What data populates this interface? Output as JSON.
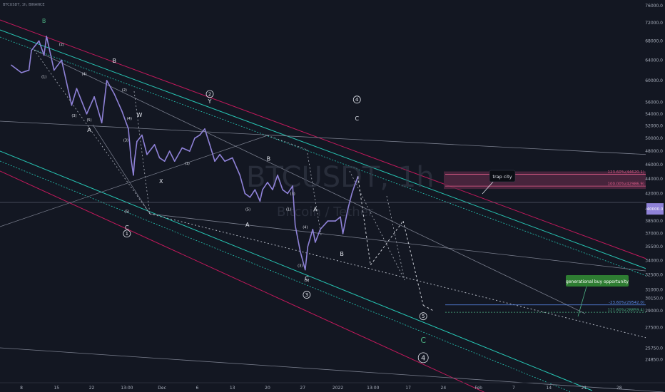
{
  "symbol": "BTCUSDT, 1h, BINANCE",
  "watermark": {
    "pair": "BTCUSDT, 1h",
    "name": "Bitcoin / Tether"
  },
  "colors": {
    "background": "#131722",
    "price": "#8f82d8",
    "wave_white": "#e0e3eb",
    "wave_green": "#4caf82",
    "wave_pink": "#e05c8a",
    "channel_teal": "#26c6b4",
    "channel_pink": "#c2185b",
    "resistance_zone": "#5a2a45",
    "current_price_tag": "#8f82d8"
  },
  "chart_data": {
    "type": "line",
    "title": "",
    "xlabel": "",
    "ylabel": "",
    "ylim": [
      24000,
      76000
    ],
    "y_scale": "log",
    "y_ticks": [
      "76000.0",
      "72000.0",
      "68000.0",
      "64000.0",
      "60000.0",
      "56000.0",
      "54000.0",
      "52000.0",
      "50000.0",
      "48000.0",
      "46000.0",
      "44000.0",
      "42000.0",
      "40000.0",
      "38500.0",
      "37000.0",
      "35500.0",
      "34000.0",
      "32500.0",
      "31000.0",
      "30150.0",
      "29000.0",
      "27500.0",
      "25750.0",
      "24850.0"
    ],
    "x_ticks": [
      "8",
      "15",
      "22",
      "13:00",
      "Dec",
      "6",
      "13",
      "20",
      "27",
      "2022",
      "13:00",
      "17",
      "24",
      "Feb",
      "7",
      "14",
      "21",
      "28"
    ],
    "series": [
      {
        "values": [
          [
            -2,
            63000
          ],
          [
            0,
            61500
          ],
          [
            1.5,
            62000
          ],
          [
            2,
            66000
          ],
          [
            3.5,
            68000
          ],
          [
            4.5,
            65000
          ],
          [
            5,
            69000
          ],
          [
            6.5,
            62000
          ],
          [
            8,
            64000
          ],
          [
            10,
            55500
          ],
          [
            11,
            58500
          ],
          [
            13,
            54000
          ],
          [
            14.5,
            57000
          ],
          [
            16,
            52500
          ],
          [
            17,
            60000
          ],
          [
            18.5,
            57500
          ],
          [
            20,
            54500
          ],
          [
            21.3,
            51500
          ],
          [
            21.8,
            47000
          ],
          [
            22.3,
            44500
          ],
          [
            22.5,
            46500
          ],
          [
            23,
            49500
          ],
          [
            24,
            50500
          ],
          [
            25,
            47500
          ],
          [
            26.5,
            49000
          ],
          [
            27.5,
            47000
          ],
          [
            28.5,
            46500
          ],
          [
            29.5,
            48000
          ],
          [
            30.5,
            46500
          ],
          [
            32,
            48500
          ],
          [
            33.5,
            48000
          ],
          [
            34.5,
            50000
          ],
          [
            35.5,
            50500
          ],
          [
            36.5,
            51500
          ],
          [
            37.5,
            49000
          ],
          [
            38.5,
            46500
          ],
          [
            39.5,
            47500
          ],
          [
            40.5,
            46500
          ],
          [
            42,
            47000
          ],
          [
            43.5,
            44500
          ],
          [
            44.5,
            42000
          ],
          [
            45.5,
            41500
          ],
          [
            46.5,
            42500
          ],
          [
            47.5,
            41000
          ],
          [
            48,
            42500
          ],
          [
            49,
            43500
          ],
          [
            50,
            42500
          ],
          [
            51,
            44500
          ],
          [
            52,
            42500
          ],
          [
            53,
            42000
          ],
          [
            54,
            43000
          ],
          [
            54.5,
            38000
          ],
          [
            55.5,
            35000
          ],
          [
            56.5,
            33000
          ],
          [
            57,
            35500
          ],
          [
            58,
            37500
          ],
          [
            58.5,
            36000
          ],
          [
            59.5,
            37500
          ],
          [
            61,
            38500
          ],
          [
            62.5,
            38500
          ],
          [
            63.5,
            39000
          ],
          [
            64,
            37000
          ],
          [
            65,
            40000
          ],
          [
            65.8,
            42000
          ],
          [
            66.3,
            43000
          ],
          [
            67,
            44300
          ]
        ]
      }
    ],
    "projected_path": [
      [
        67,
        44300
      ],
      [
        69.5,
        33500
      ],
      [
        76,
        38500
      ],
      [
        80,
        29500
      ],
      [
        82,
        29000
      ]
    ],
    "annotations": [
      {
        "text": "B",
        "x": 4.5,
        "y": 72000,
        "color": "#4caf82"
      },
      {
        "text": "B",
        "x": 18.5,
        "y": 63500,
        "color": "#e0e3eb"
      },
      {
        "text": "A",
        "x": 13.5,
        "y": 51000,
        "color": "#e0e3eb"
      },
      {
        "text": "C",
        "x": 21,
        "y": 37500,
        "color": "#e0e3eb"
      },
      {
        "text": "W",
        "x": 23.5,
        "y": 53500,
        "color": "#e0e3eb"
      },
      {
        "text": "X",
        "x": 27.8,
        "y": 43400,
        "color": "#e0e3eb"
      },
      {
        "text": "Y",
        "x": 37.5,
        "y": 55800,
        "color": "#e0e3eb"
      },
      {
        "text": "B",
        "x": 49.2,
        "y": 46600,
        "color": "#e0e3eb"
      },
      {
        "text": "A",
        "x": 45,
        "y": 37800,
        "color": "#e0e3eb"
      },
      {
        "text": "C",
        "x": 56.8,
        "y": 31900,
        "color": "#e0e3eb"
      },
      {
        "text": "A",
        "x": 58.5,
        "y": 39700,
        "color": "#e0e3eb"
      },
      {
        "text": "B",
        "x": 63.8,
        "y": 34500,
        "color": "#e0e3eb"
      },
      {
        "text": "C",
        "x": 66.8,
        "y": 52900,
        "color": "#e0e3eb"
      },
      {
        "text": "C",
        "x": 80,
        "y": 26200,
        "color": "#4caf82"
      },
      {
        "text": "(1)",
        "x": 4.5,
        "y": 60500,
        "color": "#e0e3eb"
      },
      {
        "text": "(2)",
        "x": 8,
        "y": 67000,
        "color": "#e0e3eb"
      },
      {
        "text": "(3)",
        "x": 10.5,
        "y": 53500,
        "color": "#e0e3eb"
      },
      {
        "text": "(4)",
        "x": 12.5,
        "y": 61000,
        "color": "#e0e3eb"
      },
      {
        "text": "(5)",
        "x": 13.5,
        "y": 52800,
        "color": "#e0e3eb"
      },
      {
        "text": "(2)",
        "x": 20.5,
        "y": 58000,
        "color": "#e0e3eb"
      },
      {
        "text": "(4)",
        "x": 21.5,
        "y": 53000,
        "color": "#e0e3eb"
      },
      {
        "text": "(3)",
        "x": 20.8,
        "y": 49500,
        "color": "#e0e3eb"
      },
      {
        "text": "(5)",
        "x": 21,
        "y": 39500,
        "color": "#e0e3eb"
      },
      {
        "text": "(1)",
        "x": 33,
        "y": 46000,
        "color": "#e0e3eb"
      },
      {
        "text": "(3)",
        "x": 54,
        "y": 41800,
        "color": "#e0e3eb"
      },
      {
        "text": "(4)",
        "x": 56.5,
        "y": 37600,
        "color": "#e0e3eb"
      },
      {
        "text": "(5)",
        "x": 56.8,
        "y": 31800,
        "color": "#e0e3eb"
      },
      {
        "text": "(3)",
        "x": 55.5,
        "y": 33300,
        "color": "#e0e3eb"
      },
      {
        "text": "(1)",
        "x": 53.2,
        "y": 39800,
        "color": "#e0e3eb"
      },
      {
        "text": "(5)",
        "x": 45.1,
        "y": 39800,
        "color": "#e0e3eb"
      }
    ],
    "circled_labels": [
      {
        "text": "2",
        "x": 37.5,
        "y": 57500,
        "color": "#e0e3eb"
      },
      {
        "text": "1",
        "x": 21,
        "y": 37000,
        "color": "#e0e3eb"
      },
      {
        "text": "3",
        "x": 56.8,
        "y": 30500,
        "color": "#e0e3eb"
      },
      {
        "text": "4",
        "x": 66.8,
        "y": 56500,
        "color": "#e0e3eb"
      },
      {
        "text": "5",
        "x": 80,
        "y": 28500,
        "color": "#e0e3eb"
      },
      {
        "text": "4",
        "x": 80,
        "y": 25000,
        "color": "#e0e3eb"
      }
    ],
    "levels": [
      {
        "label": "123.60%(44620.1)",
        "price": 44620.1,
        "color": "#e05c8a"
      },
      {
        "label": "100.00%(42986.9)",
        "price": 42986.9,
        "color": "#e05c8a"
      },
      {
        "label": "-23.60%(29542.0)",
        "price": 29542.0,
        "color": "#5b8def"
      },
      {
        "label": "121.60%(28859.4)",
        "price": 28859.4,
        "color": "#4caf82"
      }
    ],
    "current_price": "40000.0",
    "callouts": [
      {
        "text": "trap city",
        "style": "dark"
      },
      {
        "text": "generational buy opportunity",
        "style": "green"
      }
    ],
    "grid": false,
    "legend": "none"
  }
}
